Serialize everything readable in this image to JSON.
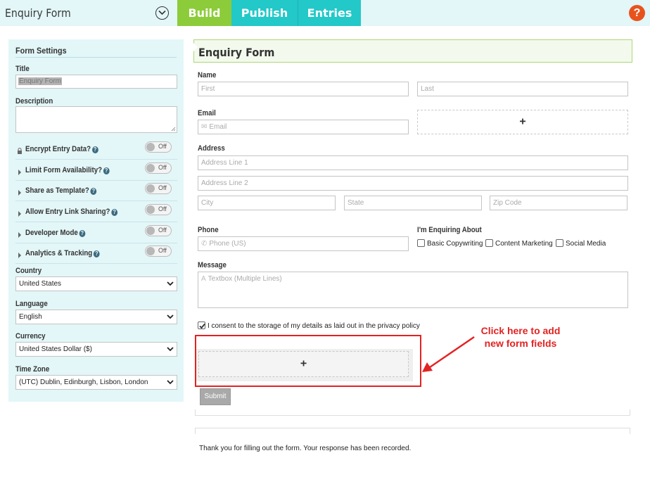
{
  "header": {
    "app_title": "Enquiry Form",
    "tabs": [
      {
        "label": "Build",
        "active": true,
        "color": "#8ccc3a"
      },
      {
        "label": "Publish",
        "active": false,
        "color": "#23c8c8"
      },
      {
        "label": "Entries",
        "active": false,
        "color": "#23c8c8"
      }
    ],
    "help_label": "?",
    "help_color": "#e8531d"
  },
  "sidebar": {
    "heading": "Form Settings",
    "title_label": "Title",
    "title_value": "Enquiry Form",
    "description_label": "Description",
    "description_value": "",
    "toggles": [
      {
        "label": "Encrypt Entry Data?",
        "icon": "lock-icon",
        "state": "Off"
      },
      {
        "label": "Limit Form Availability?",
        "icon": "caret-right-icon",
        "state": "Off"
      },
      {
        "label": "Share as Template?",
        "icon": "caret-right-icon",
        "state": "Off"
      },
      {
        "label": "Allow Entry Link Sharing?",
        "icon": "caret-right-icon",
        "state": "Off"
      },
      {
        "label": "Developer Mode",
        "icon": "caret-right-icon",
        "state": "Off"
      },
      {
        "label": "Analytics & Tracking",
        "icon": "caret-right-icon",
        "state": "Off"
      }
    ],
    "country_label": "Country",
    "country_value": "United States",
    "language_label": "Language",
    "language_value": "English",
    "currency_label": "Currency",
    "currency_value": "United States Dollar ($)",
    "timezone_label": "Time Zone",
    "timezone_value": "(UTC) Dublin, Edinburgh, Lisbon, London"
  },
  "form": {
    "title": "Enquiry Form",
    "name": {
      "label": "Name",
      "first_placeholder": "First",
      "last_placeholder": "Last"
    },
    "email": {
      "label": "Email",
      "placeholder": "Email",
      "icon": "envelope-icon"
    },
    "add_field_symbol": "+",
    "address": {
      "label": "Address",
      "line1_placeholder": "Address Line 1",
      "line2_placeholder": "Address Line 2",
      "city_placeholder": "City",
      "state_placeholder": "State",
      "zip_placeholder": "Zip Code"
    },
    "phone": {
      "label": "Phone",
      "placeholder": "Phone (US)",
      "icon": "phone-icon"
    },
    "enquiring": {
      "label": "I'm Enquiring About",
      "options": [
        "Basic Copywriting",
        "Content Marketing",
        "Social Media"
      ]
    },
    "message": {
      "label": "Message",
      "placeholder": "Textbox (Multiple Lines)",
      "icon": "text-icon"
    },
    "consent": {
      "label": "I consent to the storage of my details as laid out in the privacy policy",
      "checked": true
    },
    "submit_label": "Submit",
    "thank_you": "Thank you for filling out the form. Your response has been recorded."
  },
  "annotation": {
    "line1": "Click here to add",
    "line2": "new form fields",
    "color": "#e32222"
  }
}
